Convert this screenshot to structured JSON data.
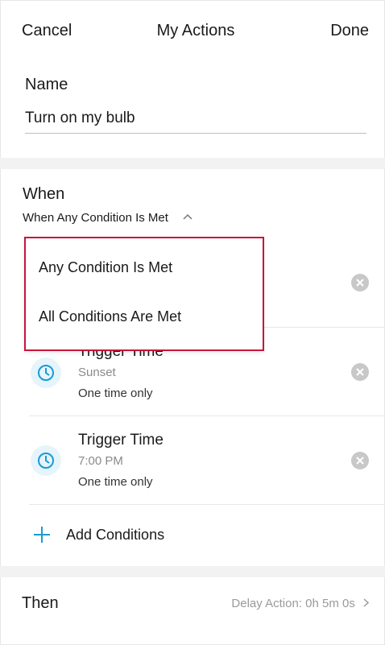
{
  "nav": {
    "cancel": "Cancel",
    "title": "My Actions",
    "done": "Done"
  },
  "name": {
    "label": "Name",
    "value": "Turn on my bulb"
  },
  "when": {
    "label": "When",
    "mode": "When Any Condition Is Met",
    "options": [
      "Any Condition Is Met",
      "All Conditions Are Met"
    ]
  },
  "conditions": [
    {
      "title": "Trigger Time",
      "time": "Sunset",
      "repeat": "One time only",
      "icon": "clock-icon"
    },
    {
      "title": "Trigger Time",
      "time": "7:00 PM",
      "repeat": "One time only",
      "icon": "clock-icon"
    }
  ],
  "add_conditions": "Add Conditions",
  "then": {
    "label": "Then",
    "delay": "Delay Action: 0h 5m 0s"
  },
  "colors": {
    "accent": "#1a9ad6",
    "dropdown_border": "#c8143c"
  }
}
